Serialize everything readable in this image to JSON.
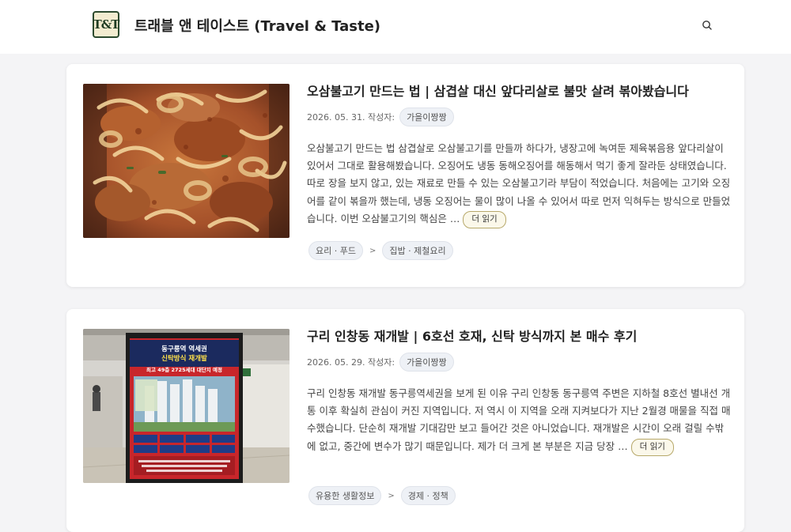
{
  "header": {
    "logo_text": "T&T",
    "site_title": "트래블 앤 테이스트 (Travel & Taste)",
    "search_icon": "search-icon"
  },
  "posts": [
    {
      "title": "오삼불고기 만드는 법 | 삼겹살 대신 앞다리살로 불맛 살려 볶아봤습니다",
      "date": "2026. 05. 31.",
      "author_label": "작성자:",
      "author": "가을이짱짱",
      "excerpt": "오삼불고기 만드는 법 삼겹살로 오삼불고기를 만들까 하다가, 냉장고에 녹여둔 제육볶음용 앞다리살이 있어서 그대로 활용해봤습니다. 오징어도 냉동 동해오징어를 해동해서 먹기 좋게 잘라둔 상태였습니다. 따로 장을 보지 않고, 있는 재료로 만들 수 있는 오삼불고기라 부담이 적었습니다. 처음에는 고기와 오징어를 같이 볶을까 했는데, 냉동 오징어는 물이 많이 나올 수 있어서 따로 먼저 익혀두는 방식으로 만들었습니다. 이번 오삼불고기의 핵심은 …",
      "more_label": "더 읽기",
      "tags": [
        "요리 · 푸드",
        "집밥 · 제철요리"
      ],
      "tag_sep": ">"
    },
    {
      "title": "구리 인창동 재개발 | 6호선 호재, 신탁 방식까지 본 매수 후기",
      "date": "2026. 05. 29.",
      "author_label": "작성자:",
      "author": "가을이짱짱",
      "excerpt": "구리 인창동 재개발 동구릉역세권을 보게 된 이유 구리 인창동 동구릉역 주변은 지하철 8호선 별내선 개통 이후 확실히 관심이 커진 지역입니다. 저 역시 이 지역을 오래 지켜보다가 지난 2월경 매물을 직접 매수했습니다. 단순히 재개발 기대감만 보고 들어간 것은 아니었습니다. 재개발은 시간이 오래 걸릴 수밖에 없고, 중간에 변수가 많기 때문입니다. 제가 더 크게 본 부분은 지금 당장 …",
      "more_label": "더 읽기",
      "tags": [
        "유용한 생활정보",
        "경제 · 정책"
      ],
      "tag_sep": ">",
      "poster": {
        "headline_a": "동구릉역 역세권",
        "headline_b": "신탁방식 재개발",
        "subline": "최고 49층 2725세대 대단지 예정"
      }
    }
  ]
}
